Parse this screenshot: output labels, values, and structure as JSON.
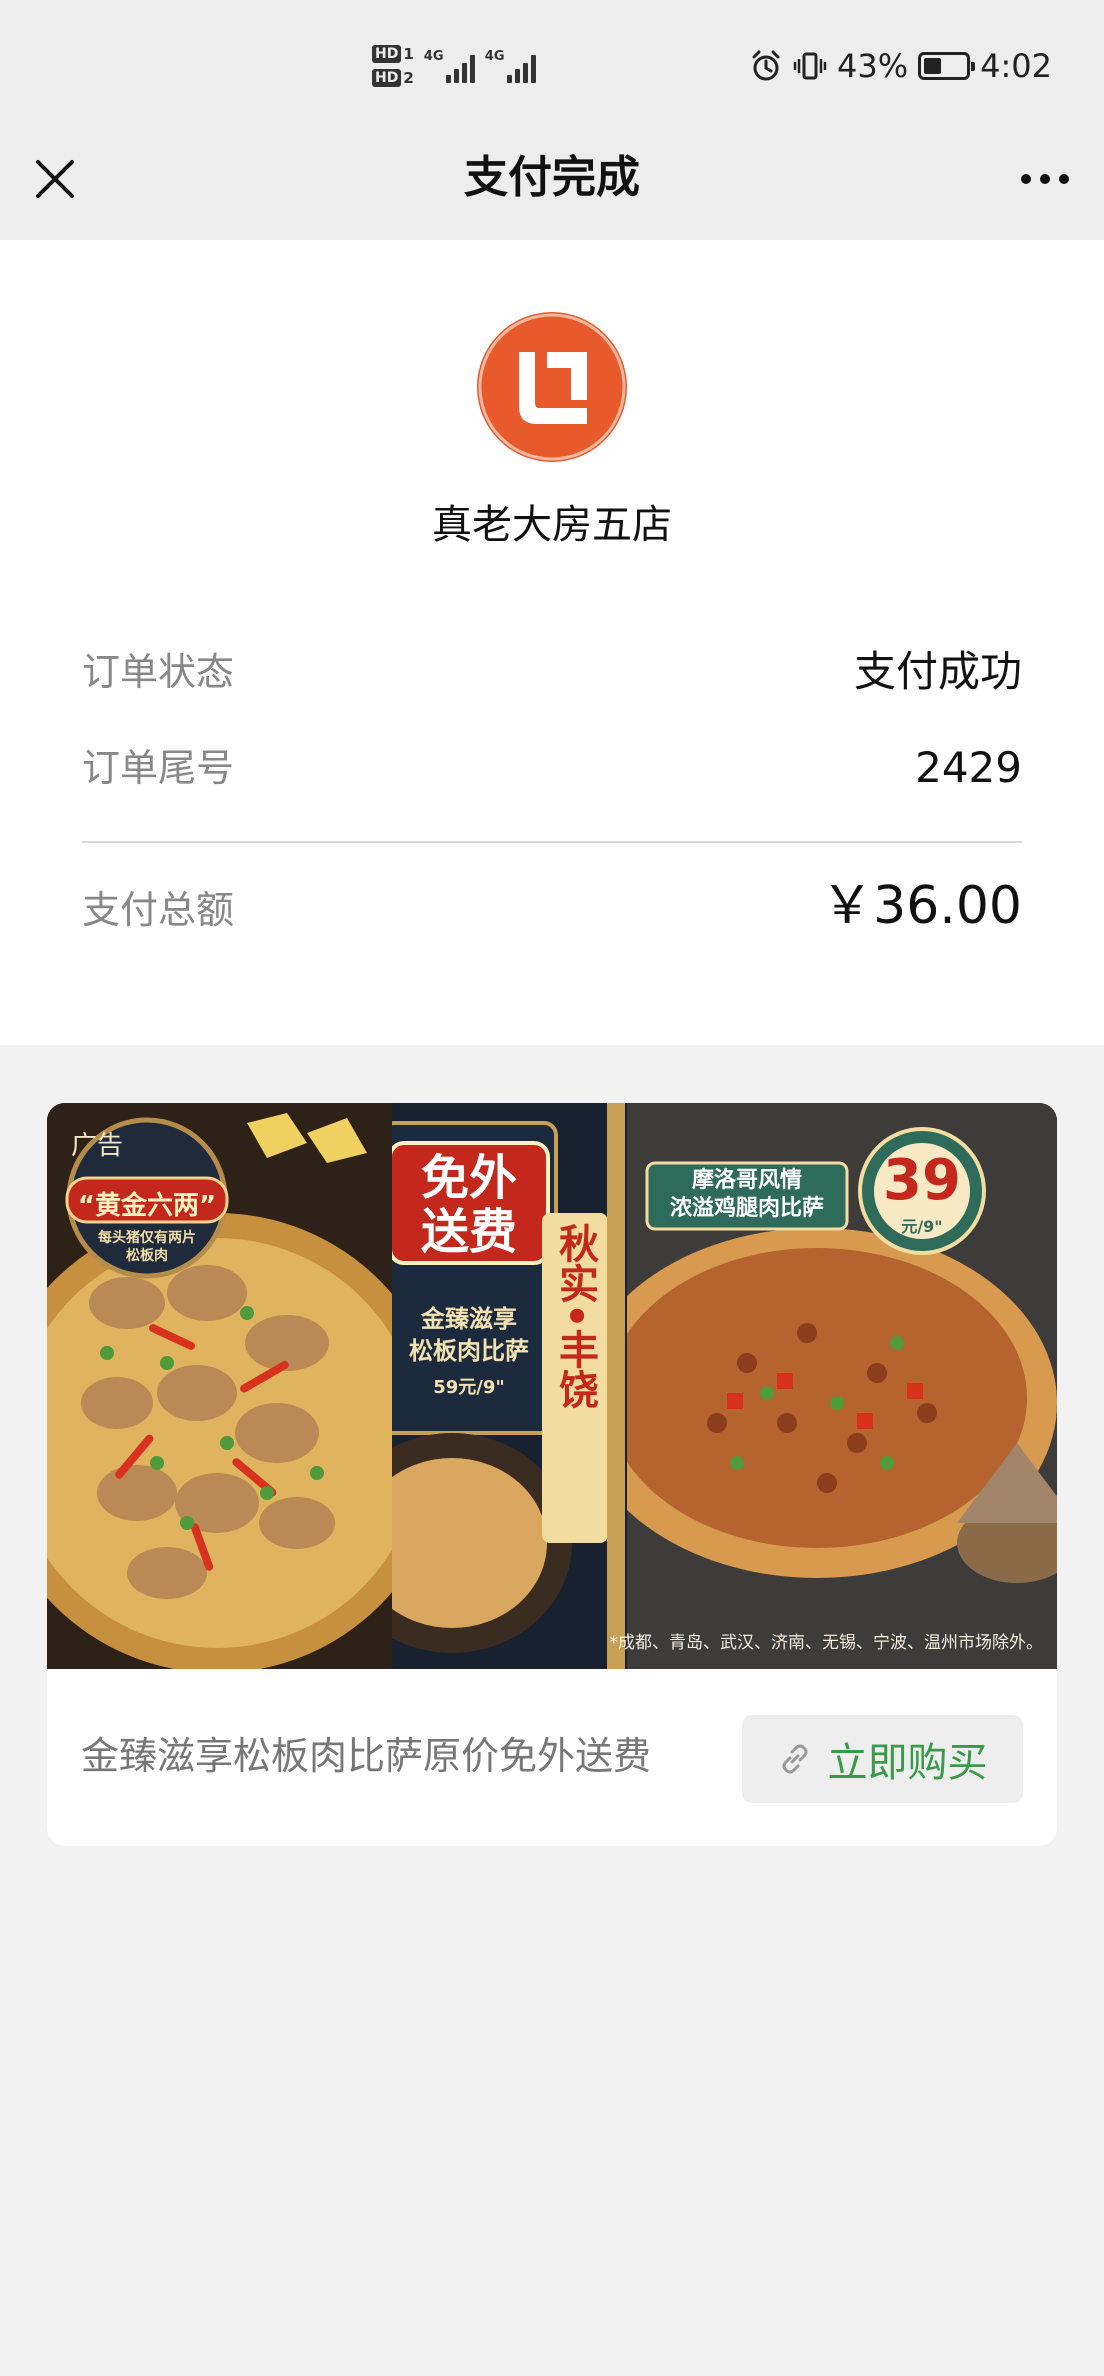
{
  "status_bar": {
    "hd1": "HD",
    "hd1_sub": "1",
    "hd2": "HD",
    "hd2_sub": "2",
    "net1": "4G",
    "net2": "4G",
    "battery_percent": "43%",
    "battery_level": 0.43,
    "time": "4:02"
  },
  "nav": {
    "title": "支付完成"
  },
  "merchant": {
    "logo_letters": "Li",
    "name": "真老大房五店"
  },
  "order": {
    "status_label": "订单状态",
    "status_value": "支付成功",
    "tail_label": "订单尾号",
    "tail_value": "2429",
    "total_label": "支付总额",
    "total_value": "￥36.00"
  },
  "ad": {
    "tag": "广告",
    "banner": {
      "left_badge": "“黄金六两”",
      "left_badge_sub": "每头猪仅有两片\n松板肉",
      "free_delivery": "免外\n送费",
      "mid_product": "金臻滋享\n松板肉比萨",
      "mid_price": "59元/9\"",
      "vertical_text": "秋实•丰饶",
      "right_title": "摩洛哥风情\n浓溢鸡腿肉比萨",
      "right_price": "39",
      "right_price_unit": "元/9\"",
      "note": "*成都、青岛、武汉、济南、无锡、宁波、温州市场除外。"
    },
    "caption": "金臻滋享松板肉比萨原价免外送费",
    "button_label": "立即购买"
  },
  "colors": {
    "logo_orange": "#e85a2c",
    "buy_green": "#3a9a4a",
    "background": "#f2f2f2"
  }
}
